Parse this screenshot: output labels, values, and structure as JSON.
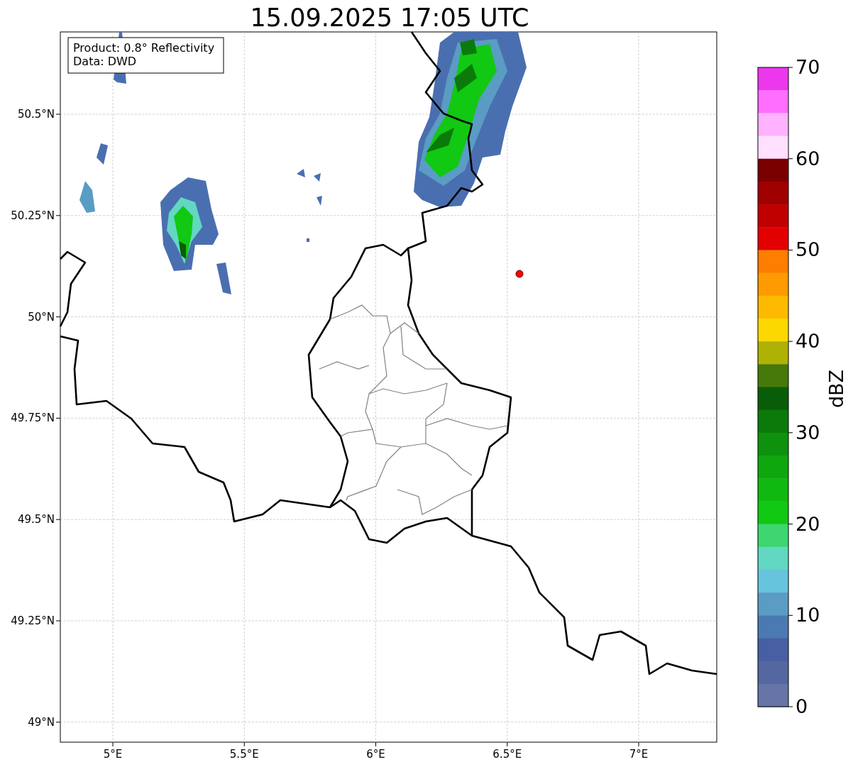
{
  "title": "15.09.2025 17:05 UTC",
  "info_box": [
    "Product: 0.8° Reflectivity",
    "Data: DWD"
  ],
  "x_ticks": [
    "5°E",
    "5.5°E",
    "6°E",
    "6.5°E",
    "7°E"
  ],
  "y_ticks": [
    "50.5°N",
    "50.25°N",
    "50°N",
    "49.75°N",
    "49.5°N",
    "49.25°N",
    "49°N"
  ],
  "colorbar": {
    "label": "dBZ",
    "ticks": [
      "70",
      "60",
      "50",
      "40",
      "30",
      "20",
      "10",
      "0"
    ],
    "bands": [
      {
        "color": "#ec37ec"
      },
      {
        "color": "#ff6eff"
      },
      {
        "color": "#ffb2ff"
      },
      {
        "color": "#ffe0ff"
      },
      {
        "color": "#7a0000"
      },
      {
        "color": "#a00000"
      },
      {
        "color": "#c00000"
      },
      {
        "color": "#e30000"
      },
      {
        "color": "#fd7e00"
      },
      {
        "color": "#fd9b00"
      },
      {
        "color": "#fdba00"
      },
      {
        "color": "#fdd800"
      },
      {
        "color": "#b0b105"
      },
      {
        "color": "#47780a"
      },
      {
        "color": "#095d09"
      },
      {
        "color": "#0b7a0b"
      },
      {
        "color": "#0e910d"
      },
      {
        "color": "#0fa70e"
      },
      {
        "color": "#10b90f"
      },
      {
        "color": "#11c812"
      },
      {
        "color": "#3dd671"
      },
      {
        "color": "#62d7c2"
      },
      {
        "color": "#66c4dc"
      },
      {
        "color": "#5a9cc4"
      },
      {
        "color": "#4a7ab1"
      },
      {
        "color": "#4660a3"
      },
      {
        "color": "#5467a0"
      },
      {
        "color": "#6675a6"
      }
    ]
  }
}
